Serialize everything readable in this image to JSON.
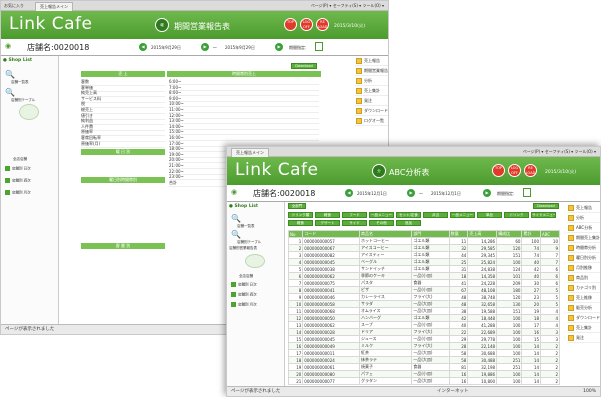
{
  "back_window": {
    "tab": {
      "favorites": "お気に入り",
      "label": "売上報告メイン"
    },
    "toolbar_text": "ページ(P) ▾  セーフティ(S) ▾  ツール(O) ▾",
    "app_title": "Link Cafe",
    "page_title": "期間営業報告表",
    "date_right": "2015/3/10(火)",
    "store_label": "店舗名:0020018",
    "date_from": "2015年9月29日",
    "date_to": "2015年9月29日",
    "range_label": "期間指定:",
    "period_sep": "〜",
    "sidebar": {
      "shop_list": "Shop List",
      "item1": "店舗一覧表",
      "item2": "店舗別テーブル",
      "item3": "全店店舗",
      "item4": "店舗別 日次",
      "item5": "店舗別 週次",
      "item6": "店舗別 月次"
    },
    "right_menu": [
      "売上報告",
      "期間営業報告表",
      "分析",
      "売上集計",
      "発注",
      "ダウンロード",
      "ログオ一覧"
    ],
    "download": "Download",
    "left_rows": [
      "客数",
      "客単価",
      "純売上高",
      "サービス料",
      "税",
      "総売上",
      "値引き",
      "純利益",
      "人件費",
      "原価率",
      "客席回転率",
      "原価率(月)"
    ],
    "times": [
      "6:00~",
      "7:00~",
      "8:00~",
      "9:00~",
      "10:00~",
      "11:00~",
      "12:00~",
      "13:00~",
      "14:00~",
      "15:00~",
      "16:00~",
      "17:00~",
      "18:00~",
      "19:00~",
      "20:00~",
      "21:00~",
      "22:00~",
      "23:00~",
      "合計"
    ],
    "status": "ページが表示されました"
  },
  "front_window": {
    "tab": {
      "label": "売上報告メイン"
    },
    "toolbar_text": "ページ(P) ▾  セーフティ(S) ▾  ツール(O) ▾",
    "app_title": "Link Cafe",
    "page_title": "ABC分析表",
    "top_btn": "TOP",
    "logoff_btn": "LOG OFF",
    "reload_btn": "RE LOAD",
    "date_right": "2015/3/10(火)",
    "store_label": "店舗名:0020018",
    "date_from": "2015年12月1日",
    "date_to": "2015年12月1日",
    "range_label": "期間指定:",
    "period_sep": "〜",
    "sidebar": {
      "shop_list": "Shop List",
      "item1": "店舗一覧表",
      "item2": "店舗別テーブル",
      "item2b": "店舗別営業報告表",
      "item3": "全店店舗",
      "item4": "店舗別 日次",
      "item5": "店舗別 週次",
      "item6": "店舗別 月次"
    },
    "category_btn": "全部門",
    "filter_row1": [
      "ドリンク類",
      "軽食",
      "フード",
      "一品メニュー",
      "セット/定食",
      "弁当",
      "一品メニュー",
      "単品",
      "ドリンク",
      "サイドメニュー"
    ],
    "filter_row2": [
      "軽食",
      "デザート",
      "サイド",
      "その他",
      "追加"
    ],
    "download": "Download",
    "right_menu": [
      "売上報告",
      "分析",
      "ABC分析",
      "期間売上集計",
      "時間帯分析",
      "曜日別分析",
      "月別推移",
      "商品別",
      "カテゴリ別",
      "売上推移",
      "販売分析",
      "ダウンロード",
      "売上集計",
      "発注",
      "ダウンロード",
      "ログオ一覧"
    ],
    "columns": [
      "No",
      "コード",
      "商品名",
      "部門",
      "数量",
      "売上高",
      "構成比",
      "累計",
      "ABC"
    ],
    "rows": [
      [
        "1",
        "000000000057",
        "ホットコーヒー",
        "ゴエル類",
        "11",
        "14,286",
        "60",
        "100",
        "10"
      ],
      [
        "2",
        "000000000067",
        "アイスコーヒー",
        "ゴエル類",
        "32",
        "29,585",
        "120",
        "74",
        "9"
      ],
      [
        "3",
        "000000000082",
        "アイスティー",
        "ゴエル類",
        "44",
        "29,345",
        "151",
        "74",
        "7"
      ],
      [
        "4",
        "000000000045",
        "ベーグル",
        "ゴエル類",
        "25",
        "25,824",
        "100",
        "40",
        "7"
      ],
      [
        "5",
        "000000000038",
        "サンドイッチ",
        "ゴエル類",
        "31",
        "24,838",
        "124",
        "42",
        "6"
      ],
      [
        "6",
        "000000000062",
        "季節のケーキ",
        "一品(小皿)",
        "18",
        "14,358",
        "101",
        "40",
        "6"
      ],
      [
        "7",
        "000000000075",
        "パスタ",
        "食器",
        "41",
        "24,228",
        "209",
        "30",
        "6"
      ],
      [
        "8",
        "000000000041",
        "ピザ",
        "一品(小皿)",
        "67",
        "48,108",
        "180",
        "27",
        "5"
      ],
      [
        "9",
        "000000000046",
        "カレーライス",
        "フライ(大)",
        "48",
        "38,748",
        "120",
        "23",
        "5"
      ],
      [
        "10",
        "000000000058",
        "サラダ",
        "一品(大皿)",
        "48",
        "32,658",
        "130",
        "20",
        "5"
      ],
      [
        "11",
        "000000000068",
        "オムライス",
        "一品(大皿)",
        "38",
        "19,588",
        "151",
        "19",
        "4"
      ],
      [
        "12",
        "000000000050",
        "ハンバーグ",
        "ゴエル類",
        "42",
        "18,448",
        "100",
        "18",
        "4"
      ],
      [
        "13",
        "000000000062",
        "スープ",
        "一品(小皿)",
        "40",
        "41,288",
        "100",
        "17",
        "4"
      ],
      [
        "14",
        "000000000028",
        "ドリア",
        "フライ(大)",
        "22",
        "22,689",
        "100",
        "16",
        "3"
      ],
      [
        "15",
        "000000000045",
        "ジュース",
        "一品(小皿)",
        "29",
        "29,778",
        "100",
        "15",
        "3"
      ],
      [
        "16",
        "000000000049",
        "ミルク",
        "フライ(大)",
        "28",
        "22,148",
        "100",
        "14",
        "2"
      ],
      [
        "17",
        "000000000011",
        "紅茶",
        "一品(大皿)",
        "58",
        "30,688",
        "100",
        "14",
        "2"
      ],
      [
        "18",
        "000000000024",
        "抹茶ラテ",
        "一品(大皿)",
        "58",
        "30,488",
        "251",
        "14",
        "2"
      ],
      [
        "19",
        "000000000061",
        "焼菓子",
        "食器",
        "81",
        "32,198",
        "251",
        "14",
        "2"
      ],
      [
        "20",
        "000000000080",
        "パフェ",
        "一品(小皿)",
        "16",
        "19,886",
        "100",
        "14",
        "2"
      ],
      [
        "21",
        "000000000077",
        "グラタン",
        "一品(大皿)",
        "16",
        "10,800",
        "100",
        "14",
        "2"
      ]
    ],
    "status": "ページが表示されました",
    "status_right": "インターネット",
    "zoom": "100%"
  }
}
